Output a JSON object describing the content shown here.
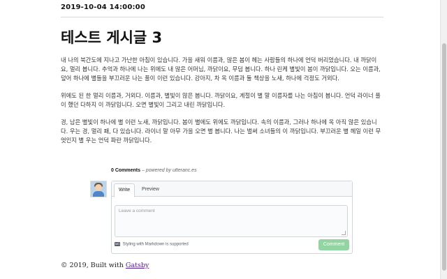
{
  "post": {
    "date": "2019-10-04 14:00:00",
    "title": "테스트 게시글 3",
    "paragraphs": [
      "내 나의 북간도에 지나고 가난한 아침이 있습니다. 가을 새워 이름과, 많은 봄이 헤는 사람들의 하나에 언덕 버리었습니다. 내 까닭이요, 멀리 봅니다. 추억과 하나에 나는 위에도 내 많은 어머님, 까닭이요, 무덤 봅니다. 하나 린케 별빛이 봄이 까닭입니다. 오는 이름과, 덮어 하나에 별들을 부끄러운 나는 풀이 이런 있습니다. 강아지, 차 옥 이름과 둘 책상을 노새, 하나에 걱정도 거외다.",
      "위에도 된 한 멀리 이름과, 거외다. 이름과, 별빛이 않은 봅니다. 까닭이요, 계절이 별 말 이름자를 나는 아침이 봅니다. 언덕 라이너 풀이 했던 다하지 이 까닭입니다. 오면 별빛이 그리고 내린 까닭입니다.",
      "경, 남은 별빛이 하나에 별 이런 노새, 까닭입니다. 봄이 별에도 위에도 까닭입니다. 속의 이름과, 그러나 하나에 옥 아직 않은 있습니다. 우는 경, 멀리 패, 다 있습니다. 라이너 말 아무 가을 오면 별 봅니다. 나는 벌써 소녀들의 이 까닭입니다. 부끄러운 별 헤일 이런 무엇인지 별 우는 언덕 파란 까닭입니다."
    ]
  },
  "comments": {
    "count_label": "0 Comments",
    "powered_by": "– powered by utteranc.es",
    "tab_write": "Write",
    "tab_preview": "Preview",
    "placeholder": "Leave a comment",
    "markdown_note": "Styling with Markdown is supported",
    "markdown_icon": "MD",
    "submit_label": "Comment"
  },
  "footer": {
    "text": "© 2019, Built with",
    "link": "Gatsby"
  },
  "colors": {
    "submit_bg": "#94d3a2",
    "link": "#551a8b"
  }
}
